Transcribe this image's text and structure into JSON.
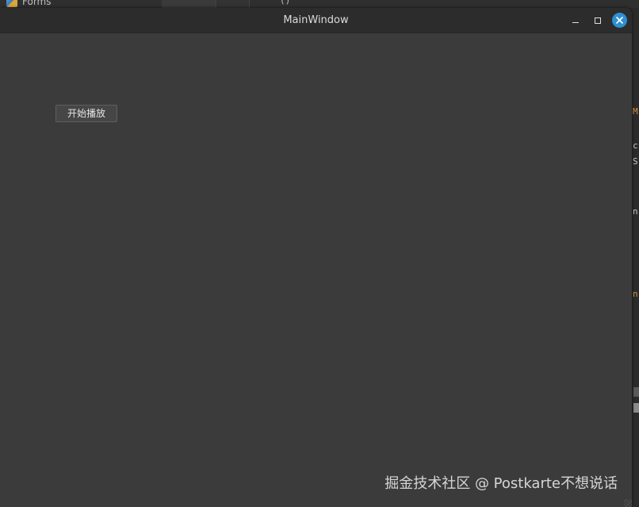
{
  "background": {
    "ide_tab_label": "Forms",
    "ide_paren": "()",
    "right_glyphs": [
      "M",
      "c",
      "S",
      "n",
      "n"
    ]
  },
  "window": {
    "title": "MainWindow",
    "controls": {
      "minimize": "minimize-icon",
      "maximize": "maximize-icon",
      "close": "close-icon"
    },
    "accent_color": "#2f8fd3"
  },
  "content": {
    "play_button_label": "开始播放"
  },
  "watermark": "掘金技术社区 @ Postkarte不想说话"
}
